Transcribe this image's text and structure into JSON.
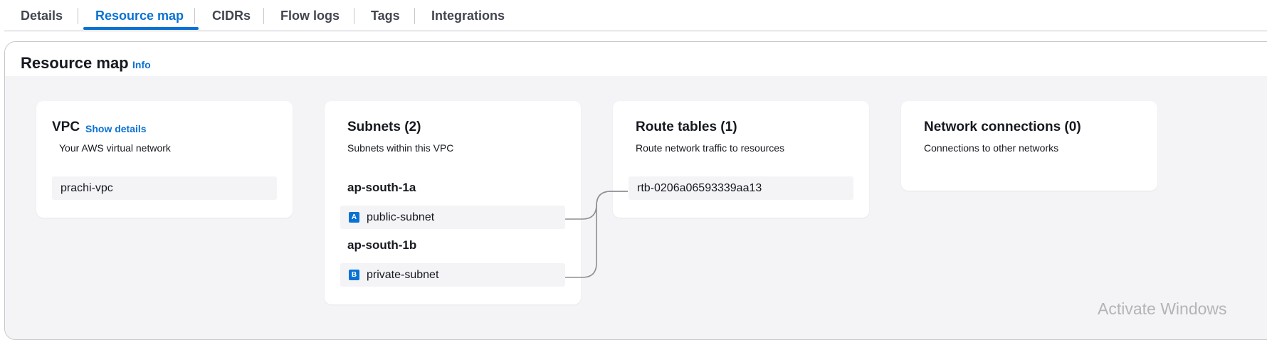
{
  "tabs": [
    {
      "label": "Details",
      "active": false
    },
    {
      "label": "Resource map",
      "active": true
    },
    {
      "label": "CIDRs",
      "active": false
    },
    {
      "label": "Flow logs",
      "active": false
    },
    {
      "label": "Tags",
      "active": false
    },
    {
      "label": "Integrations",
      "active": false
    }
  ],
  "section": {
    "title": "Resource map",
    "info_label": "Info"
  },
  "vpc": {
    "title": "VPC",
    "show_details_label": "Show details",
    "description": "Your AWS virtual network",
    "item": "prachi-vpc"
  },
  "subnets": {
    "title": "Subnets (2)",
    "description": "Subnets within this VPC",
    "zones": [
      {
        "az": "ap-south-1a",
        "badge": "A",
        "subnet": "public-subnet"
      },
      {
        "az": "ap-south-1b",
        "badge": "B",
        "subnet": "private-subnet"
      }
    ]
  },
  "route_tables": {
    "title": "Route tables (1)",
    "description": "Route network traffic to resources",
    "items": [
      "rtb-0206a06593339aa13"
    ]
  },
  "network_connections": {
    "title": "Network connections (0)",
    "description": "Connections to other networks"
  },
  "watermark": "Activate Windows",
  "colors": {
    "accent": "#0972d3",
    "map_background": "#f4f4f7",
    "connector": "#8d8d94"
  }
}
